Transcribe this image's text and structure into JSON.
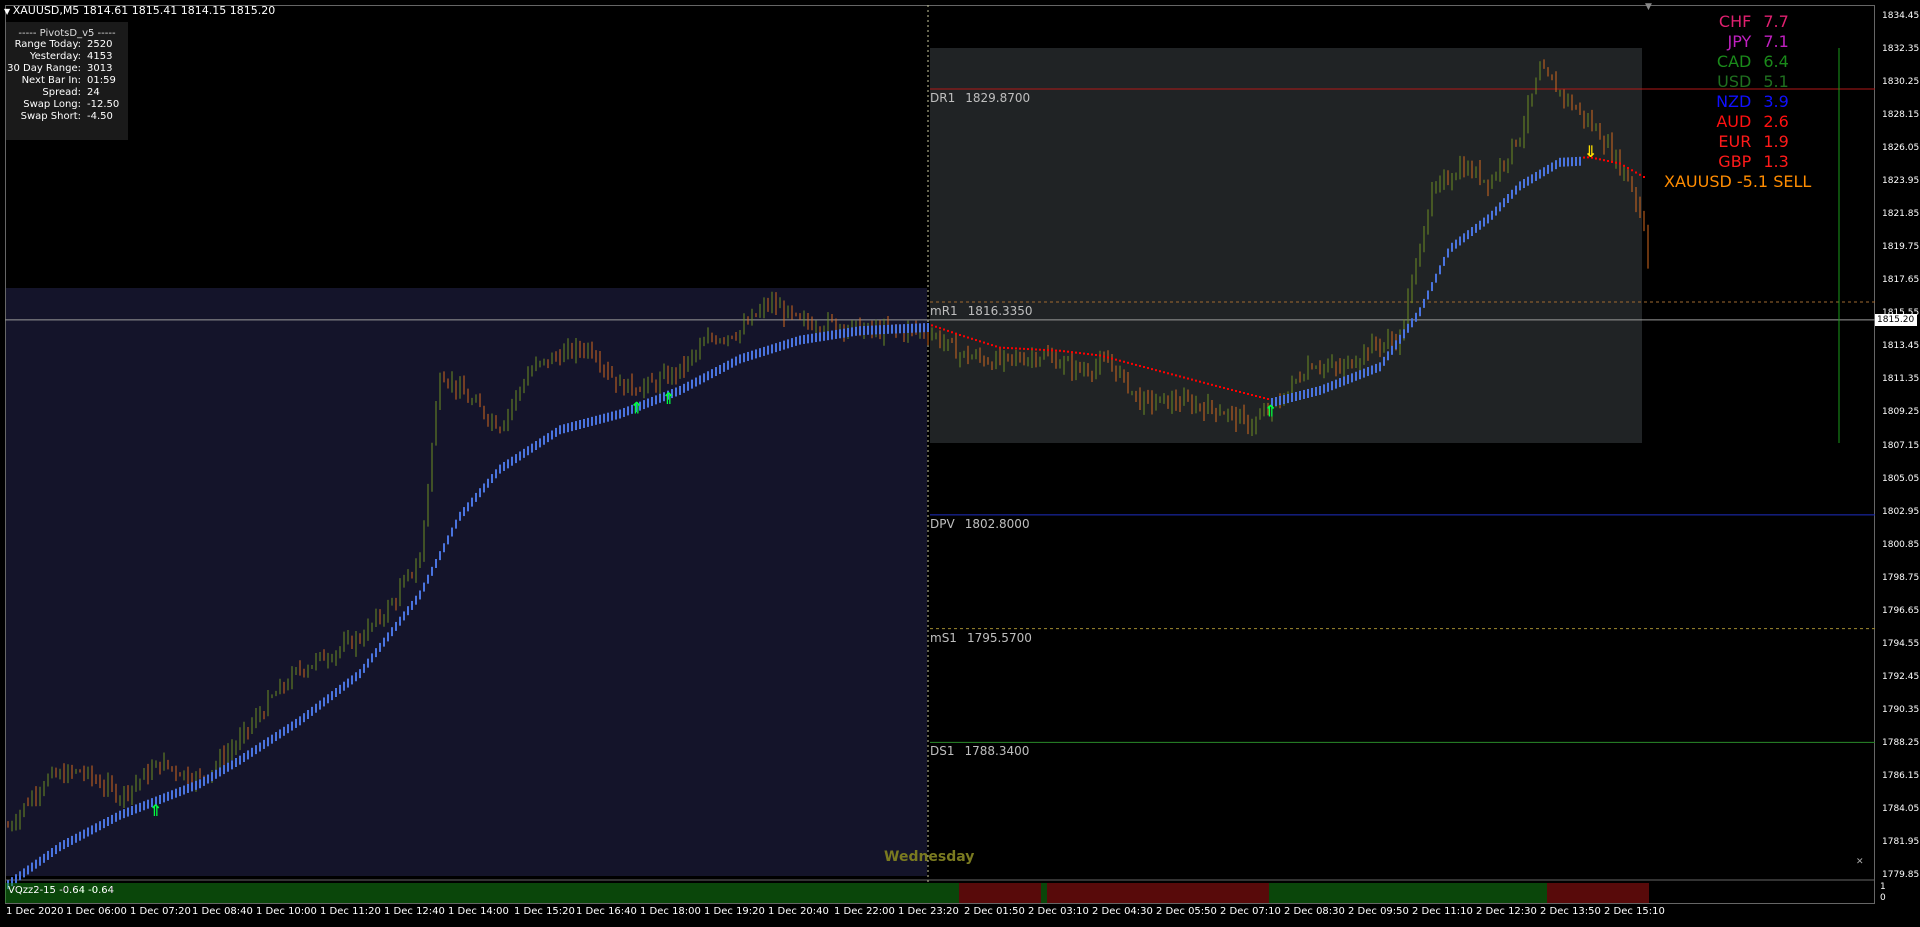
{
  "header": {
    "symbol": "XAUUSD,M5",
    "ohlc": "1814.61 1815.41 1814.15 1815.20"
  },
  "pivots_panel": {
    "title": "----- PivotsD_v5 -----",
    "rows": [
      {
        "label": "Range Today:",
        "value": "2520"
      },
      {
        "label": "Yesterday:",
        "value": "4153"
      },
      {
        "label": "30 Day Range:",
        "value": "3013"
      },
      {
        "label": "Next Bar In:",
        "value": "01:59"
      },
      {
        "label": "Spread:",
        "value": "24"
      },
      {
        "label": "Swap Long:",
        "value": "-12.50"
      },
      {
        "label": "Swap Short:",
        "value": "-4.50"
      }
    ]
  },
  "currency_strength": [
    {
      "currency": "CHF",
      "value": "7.7",
      "color": "#e0206f"
    },
    {
      "currency": "JPY",
      "value": "7.1",
      "color": "#c020c0"
    },
    {
      "currency": "CAD",
      "value": "6.4",
      "color": "#1a8a1a"
    },
    {
      "currency": "USD",
      "value": "5.1",
      "color": "#1f6f1f"
    },
    {
      "currency": "NZD",
      "value": "3.9",
      "color": "#1010ff"
    },
    {
      "currency": "AUD",
      "value": "2.6",
      "color": "#ff1010"
    },
    {
      "currency": "EUR",
      "value": "1.9",
      "color": "#ff1a1a"
    },
    {
      "currency": "GBP",
      "value": "1.3",
      "color": "#ff1a1a"
    }
  ],
  "signal": {
    "text": "XAUUSD -5.1 SELL"
  },
  "pivot_levels": [
    {
      "name": "DR1",
      "price": "1829.8700",
      "value": 1829.87,
      "color": "#b01818",
      "dashed": false
    },
    {
      "name": "mR1",
      "price": "1816.3350",
      "value": 1816.335,
      "color": "#a06a30",
      "dashed": true
    },
    {
      "name": "DPV",
      "price": "1802.8000",
      "value": 1802.8,
      "color": "#1e2ec0",
      "dashed": false
    },
    {
      "name": "mS1",
      "price": "1795.5700",
      "value": 1795.57,
      "color": "#a08a30",
      "dashed": true
    },
    {
      "name": "DS1",
      "price": "1788.3400",
      "value": 1788.34,
      "color": "#2a8a2a",
      "dashed": false
    }
  ],
  "price_axis": {
    "ticks": [
      "1834.45",
      "1832.35",
      "1830.25",
      "1828.15",
      "1826.05",
      "1823.95",
      "1821.85",
      "1819.75",
      "1817.65",
      "1815.55",
      "1813.45",
      "1811.35",
      "1809.25",
      "1807.15",
      "1805.05",
      "1802.95",
      "1800.85",
      "1798.75",
      "1796.65",
      "1794.55",
      "1792.45",
      "1790.35",
      "1788.25",
      "1786.15",
      "1784.05",
      "1781.95",
      "1779.85"
    ],
    "current": "1815.20"
  },
  "time_axis": {
    "ticks": [
      "1 Dec 2020",
      "1 Dec 06:00",
      "1 Dec 07:20",
      "1 Dec 08:40",
      "1 Dec 10:00",
      "1 Dec 11:20",
      "1 Dec 12:40",
      "1 Dec 14:00",
      "1 Dec 15:20",
      "1 Dec 16:40",
      "1 Dec 18:00",
      "1 Dec 19:20",
      "1 Dec 20:40",
      "1 Dec 22:00",
      "1 Dec 23:20",
      "2 Dec 01:50",
      "2 Dec 03:10",
      "2 Dec 04:30",
      "2 Dec 05:50",
      "2 Dec 07:10",
      "2 Dec 08:30",
      "2 Dec 09:50",
      "2 Dec 11:10",
      "2 Dec 12:30",
      "2 Dec 13:50",
      "2 Dec 15:10"
    ]
  },
  "day_label": "Wednesday",
  "indicator": {
    "label": "VQzz2-15 -0.64 -0.64",
    "scale_top": "1",
    "scale_bottom": "0"
  },
  "colors": {
    "bull": "#6b8e23",
    "bear": "#d2691e",
    "ma_up": "#4a74e0",
    "ma_down": "#ff0000",
    "prev_day_bg": "#14142a",
    "today_range_bg": "#202325"
  },
  "ui": {
    "scroll_marker": "▼",
    "fix_button": "✕"
  }
}
